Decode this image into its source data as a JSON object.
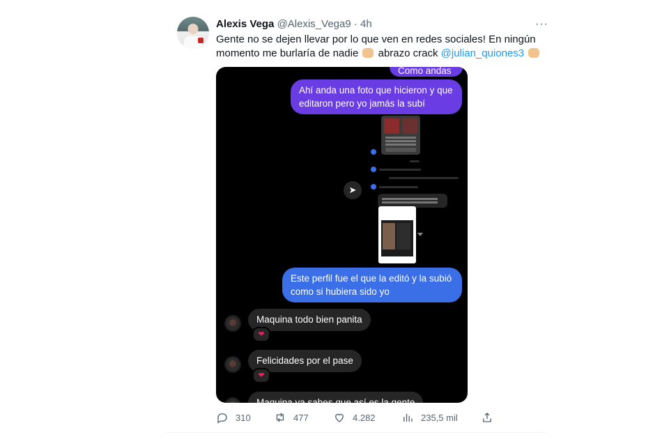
{
  "tweet": {
    "author_name": "Alexis Vega",
    "handle": "@Alexis_Vega9",
    "separator": "·",
    "time": "4h",
    "text_part1": "Gente no se dejen llevar por lo que ven en redes sociales! En ningún momento me burlaría de nadie",
    "text_part2": "abrazo crack",
    "mention": "@julian_quiones3",
    "emoji1_name": "raising-hands-emoji",
    "emoji2_name": "clapping-hands-emoji",
    "more_label": "···"
  },
  "media": {
    "messages_out": [
      "Como andas ?",
      "Ahí anda una foto que hicieron y que editaron pero yo jamás la subí",
      "Este perfil fue el que la editó y la subió como si hubiera sido yo"
    ],
    "messages_in": [
      "Maquina todo bien panita",
      "Felicidades por el pase",
      "Maquina ya sabes que así es la gente"
    ],
    "reaction": "❤"
  },
  "actions": {
    "replies": "310",
    "retweets": "477",
    "likes": "4.282",
    "views": "235,5 mil"
  },
  "colors": {
    "accent": "#1d9bf0",
    "bubble_purple": "#6a3ce3",
    "bubble_blue": "#3b6fe8",
    "bubble_gray": "#262626",
    "heart": "#e0245e"
  }
}
